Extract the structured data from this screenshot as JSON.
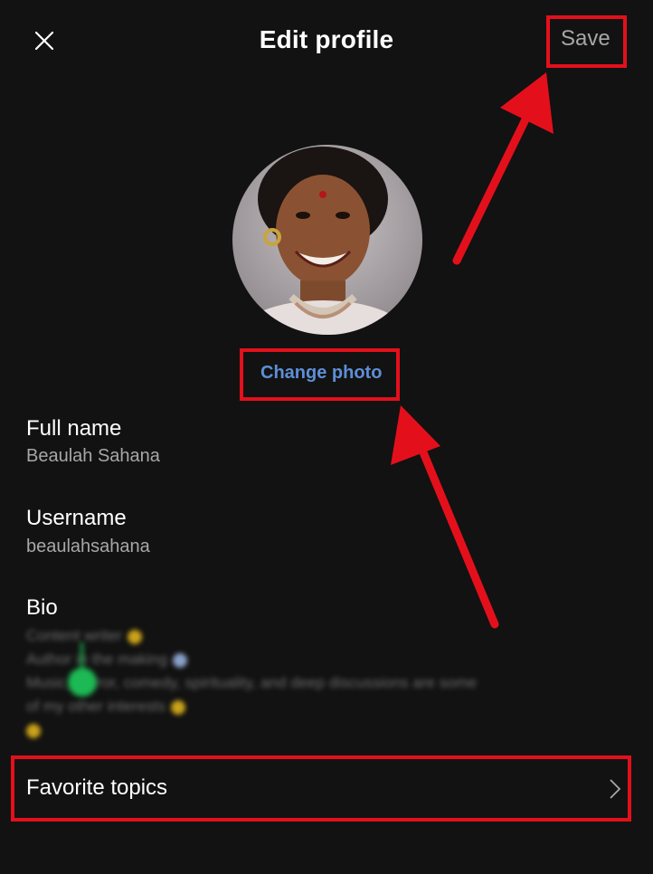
{
  "header": {
    "title": "Edit profile",
    "save_label": "Save",
    "close_icon": "close-icon"
  },
  "profile": {
    "avatar_icon": "avatar-photo",
    "change_photo_label": "Change photo"
  },
  "fields": {
    "full_name": {
      "label": "Full name",
      "value": "Beaulah Sahana"
    },
    "username": {
      "label": "Username",
      "value": "beaulahsahana"
    },
    "bio": {
      "label": "Bio",
      "lines": [
        "Content writer",
        "Author in the making",
        "Music, horror, comedy, spirituality, and deep discussions are some",
        "of my other interests"
      ]
    }
  },
  "favorite_topics": {
    "label": "Favorite topics",
    "icon": "chevron-right-icon"
  },
  "colors": {
    "background": "#121212",
    "link_blue": "#5d8fd6",
    "secondary_text": "#a7a7a7",
    "annotation_red": "#e3101c"
  }
}
